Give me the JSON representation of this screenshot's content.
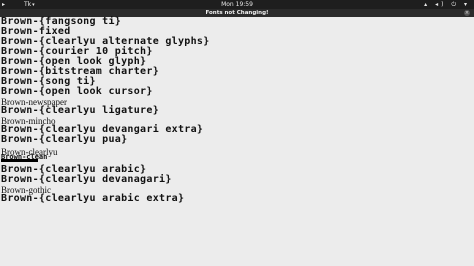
{
  "topbar": {
    "activities": "▸",
    "app_menu": "Tk",
    "app_menu_caret": "▾",
    "clock": "Mon 19:59",
    "status_icons": "▴ ◂) ⏻ ▾"
  },
  "window": {
    "title": "Fonts not Changing!",
    "close_glyph": "×"
  },
  "terminal_lines": [
    "Brown-{fangsong ti}",
    "Brown-fixed",
    "Brown-{clearlyu alternate glyphs}",
    "Brown-{courier 10 pitch}",
    "Brown-{open look glyph}",
    "Brown-{bitstream charter}",
    "Brown-{song ti}",
    "Brown-{open look cursor}",
    "Brown-newspaper",
    "Brown-{clearlyu ligature}",
    "Brown-mincho",
    "Brown-{clearlyu devangari extra}",
    "Brown-{clearlyu pua}",
    "Brown-clearlyu",
    "Brown-clean",
    "",
    "Brown-{clearlyu arabic}",
    "Brown-{clearlyu devanagari}",
    "Brown-gothic",
    "Brown-{clearlyu arabic extra}"
  ]
}
